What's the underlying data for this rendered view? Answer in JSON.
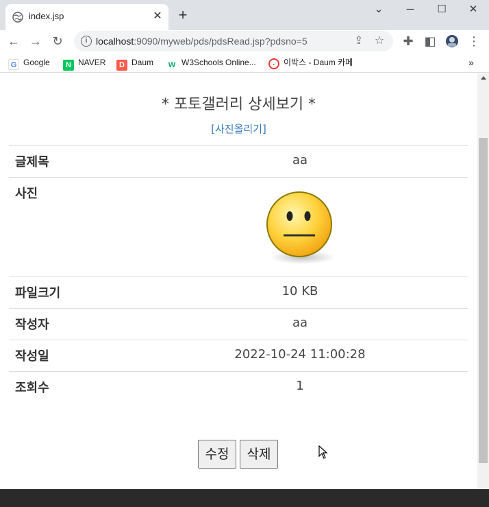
{
  "browser": {
    "tab_title": "index.jsp",
    "url_host": "localhost",
    "url_rest": ":9090/myweb/pds/pdsRead.jsp?pdsno=5",
    "bookmarks": [
      {
        "label": "Google",
        "icon": "google-icon",
        "color": "#4285f4"
      },
      {
        "label": "NAVER",
        "icon": "naver-icon",
        "color": "#03c75a"
      },
      {
        "label": "Daum",
        "icon": "daum-icon",
        "color": "#ff5a4a"
      },
      {
        "label": "W3Schools Online...",
        "icon": "w3schools-icon",
        "color": "#04aa6d"
      },
      {
        "label": "이박스 - Daum 카페",
        "icon": "daum-cafe-icon",
        "color": "#e53935"
      }
    ]
  },
  "page": {
    "title": "* 포토갤러리 상세보기 *",
    "upload_link": "[사진올리기]",
    "rows": [
      {
        "label": "글제목",
        "value": "aa"
      },
      {
        "label": "사진",
        "value": ""
      },
      {
        "label": "파일크기",
        "value": "10 KB"
      },
      {
        "label": "작성자",
        "value": "aa"
      },
      {
        "label": "작성일",
        "value": "2022-10-24 11:00:28"
      },
      {
        "label": "조회수",
        "value": "1"
      }
    ],
    "buttons": {
      "edit": "수정",
      "delete": "삭제"
    }
  },
  "colors": {
    "link": "#337ab7",
    "footer": "#2a2a2a"
  }
}
